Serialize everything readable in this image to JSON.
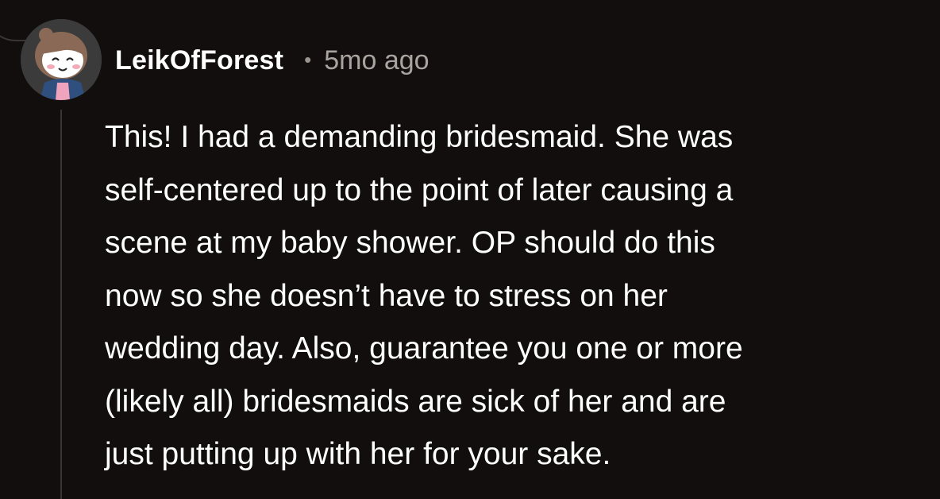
{
  "comment": {
    "username": "LeikOfForest",
    "separator": "•",
    "timestamp": "5mo ago",
    "avatar_icon": "cartoon-girl-avatar-icon",
    "body_lines": [
      "This! I had a demanding bridesmaid. She was",
      "self-centered up to the point of later causing a",
      "scene at my baby shower. OP should do this",
      "now so she doesn’t have to stress on her",
      "wedding day. Also, guarantee you one or more",
      "(likely all) bridesmaids are sick of her and are",
      "just putting up with her for your sake."
    ]
  },
  "colors": {
    "background": "#120e0d",
    "thread_line": "#3a3533",
    "username": "#ffffff",
    "timestamp": "#a9a4a0",
    "body_text": "#ffffff"
  }
}
